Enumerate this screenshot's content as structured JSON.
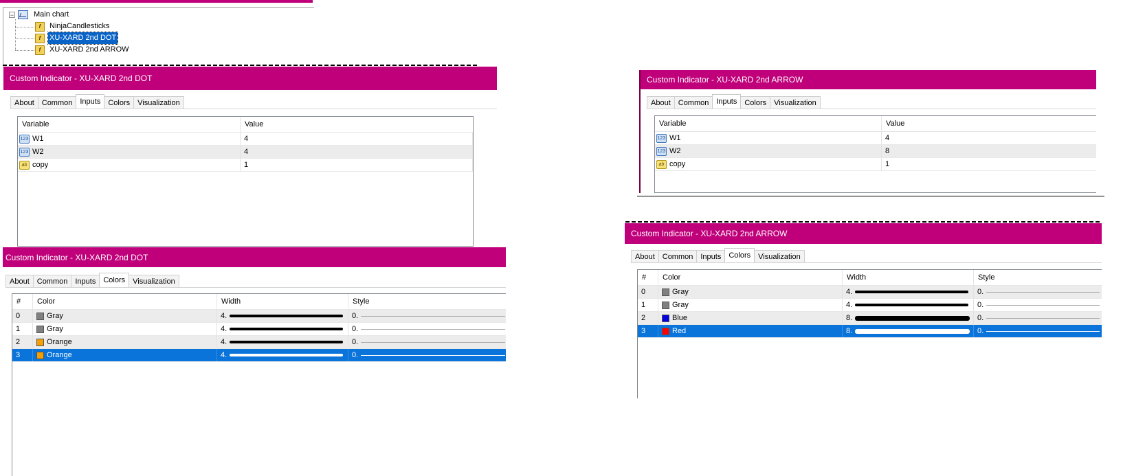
{
  "colors": {
    "titlebar": "#c0007a",
    "selection": "#0a74da",
    "gray": "#808080",
    "orange": "#f5a000",
    "blue": "#0000e0",
    "red": "#ff0000"
  },
  "tree": {
    "root": "Main chart",
    "items": [
      "NinjaCandlesticks",
      "XU-XARD 2nd DOT",
      "XU-XARD 2nd ARROW"
    ],
    "selected_index": 1,
    "expander": "−"
  },
  "tabs": [
    "About",
    "Common",
    "Inputs",
    "Colors",
    "Visualization"
  ],
  "icons": {
    "int": "123",
    "str": "ab",
    "fx": "f"
  },
  "inputs_headers": {
    "variable": "Variable",
    "value": "Value"
  },
  "colors_headers": {
    "num": "#",
    "color": "Color",
    "width": "Width",
    "style": "Style"
  },
  "dot_inputs": {
    "title": "Custom Indicator - XU-XARD 2nd DOT",
    "rows": [
      {
        "name": "W1",
        "value": "4"
      },
      {
        "name": "W2",
        "value": "4"
      },
      {
        "name": "copy",
        "value": "1"
      }
    ]
  },
  "arrow_inputs": {
    "title": "Custom Indicator - XU-XARD 2nd ARROW",
    "rows": [
      {
        "name": "W1",
        "value": "4"
      },
      {
        "name": "W2",
        "value": "8"
      },
      {
        "name": "copy",
        "value": "1"
      }
    ]
  },
  "dot_colors": {
    "title": "Custom Indicator - XU-XARD 2nd DOT",
    "rows": [
      {
        "num": "0",
        "color": "Gray",
        "width": "4.",
        "style": "0."
      },
      {
        "num": "1",
        "color": "Gray",
        "width": "4.",
        "style": "0."
      },
      {
        "num": "2",
        "color": "Orange",
        "width": "4.",
        "style": "0."
      },
      {
        "num": "3",
        "color": "Orange",
        "width": "4.",
        "style": "0."
      }
    ]
  },
  "arrow_colors": {
    "title": "Custom Indicator - XU-XARD 2nd ARROW",
    "rows": [
      {
        "num": "0",
        "color": "Gray",
        "width": "4.",
        "style": "0."
      },
      {
        "num": "1",
        "color": "Gray",
        "width": "4.",
        "style": "0."
      },
      {
        "num": "2",
        "color": "Blue",
        "width": "8.",
        "style": "0."
      },
      {
        "num": "3",
        "color": "Red",
        "width": "8.",
        "style": "0."
      }
    ]
  }
}
